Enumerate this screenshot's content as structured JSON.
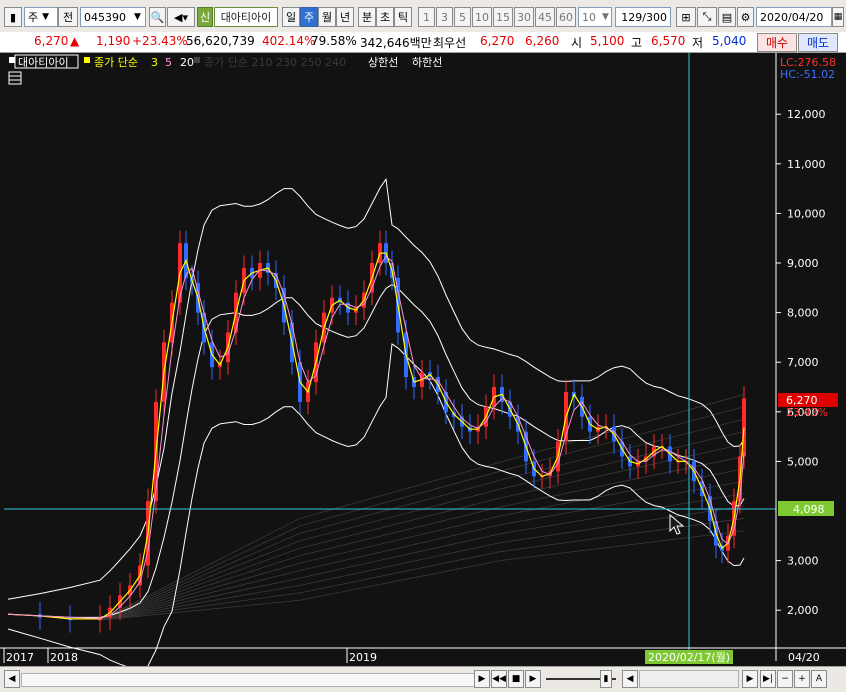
{
  "toolbar": {
    "period_select": "주",
    "prev_label": "전",
    "code": "045390",
    "credit_badge": "신",
    "stock_name": "대아티아이",
    "periods": [
      "일",
      "주",
      "월",
      "년",
      "분",
      "초",
      "틱"
    ],
    "active_period": "주",
    "intervals": [
      "1",
      "3",
      "5",
      "10",
      "15",
      "30",
      "45",
      "60"
    ],
    "interval_value": "10",
    "count_value": "129",
    "count_total": "/300",
    "date_value": "2020/04/20"
  },
  "quote": {
    "price": "6,270",
    "change": "1,190",
    "change_pct": "+23.43%",
    "volume": "56,620,739",
    "vol_ratio": "402.14%",
    "turnover": "79.58%",
    "amount": "342,646백만",
    "prior_label": "최우선",
    "ask": "6,270",
    "bid": "6,260",
    "open_label": "시",
    "open": "5,100",
    "high_label": "고",
    "high": "6,570",
    "low_label": "저",
    "low": "5,040",
    "buy_label": "매수",
    "sell_label": "매도"
  },
  "legend": {
    "name": "대아티아이",
    "ma_label": "종가 단순",
    "ma1": "3",
    "ma2": "5",
    "ma3": "20",
    "hidden_label": "종가 단순 210 230 250 240",
    "upper_band": "상한선",
    "lower_band": "하한선"
  },
  "side": {
    "lc": "LC:276.58",
    "hc": "HC:-51.02",
    "last_price": "6,270",
    "last_pct": "23.43%",
    "cursor_price": "4,098",
    "cursor_date": "2020/02/17(월)",
    "last_date": "04/20"
  },
  "colors": {
    "up": "#ff2a2a",
    "down": "#2f6cff",
    "ma3": "#ffff00",
    "ma5": "#ff8fd8",
    "band": "#ffffff",
    "crosshair": "#30c8d8",
    "cursor_badge": "#7ec832",
    "price_badge": "#e00000"
  },
  "chart_data": {
    "type": "candlestick",
    "y_ticks": [
      "12,000",
      "11,000",
      "10,000",
      "9,000",
      "8,000",
      "7,000",
      "6,000",
      "5,000",
      "3,000",
      "2,000"
    ],
    "x_labels": [
      "2017",
      "2018",
      "2019"
    ],
    "ylim": [
      1000,
      12800
    ]
  }
}
